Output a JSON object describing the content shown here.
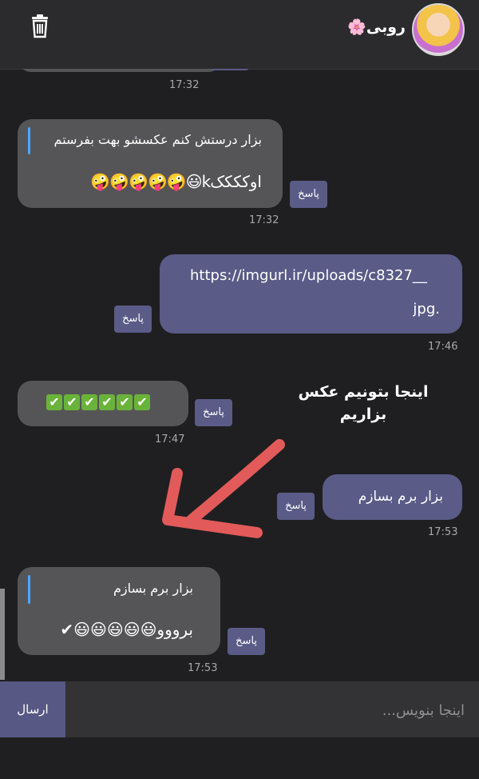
{
  "header": {
    "contact_name": "روبی🌸",
    "trash_icon": "trash-icon",
    "avatar": "avatar-image"
  },
  "messages": [
    {
      "id": "m0",
      "direction": "in",
      "text": "",
      "time": "17:32"
    },
    {
      "id": "m1",
      "direction": "in",
      "quote": "بزار درستش کنم عکسشو بهت بفرستم",
      "text": "اوککککk😃🤪🤪🤪🤪🤪",
      "time": "17:32",
      "reply_label": "پاسخ"
    },
    {
      "id": "m2",
      "direction": "out",
      "text_line1": "https://imgurl.ir/uploads/c8327__",
      "text_line2": ".jpg",
      "time": "17:46",
      "reply_label": "پاسخ"
    },
    {
      "id": "m3",
      "direction": "in",
      "text": "✔✔✔✔✔✔",
      "time": "17:47",
      "reply_label": "پاسخ"
    },
    {
      "id": "m4",
      "direction": "out",
      "text": "بزار برم بسازم",
      "time": "17:53",
      "reply_label": "پاسخ"
    },
    {
      "id": "m5",
      "direction": "in",
      "quote": "بزار برم بسازم",
      "text": "برووو😃😃😃😃😃✔",
      "time": "17:53",
      "reply_label": "پاسخ"
    }
  ],
  "annotation": {
    "line1": "اینجا بتونیم عکس",
    "line2": "بزاریم",
    "arrow_color": "#e25a5a"
  },
  "composer": {
    "placeholder": "اینجا بنویس...",
    "send_label": "ارسال"
  },
  "colors": {
    "background": "#1f1f21",
    "incoming": "#555557",
    "outgoing": "#5a5b87",
    "accent": "#4aa8ff"
  }
}
